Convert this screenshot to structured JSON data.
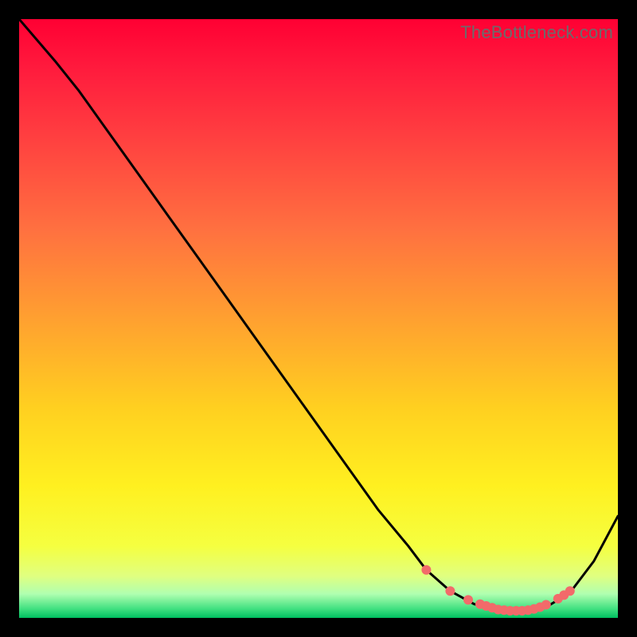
{
  "watermark": "TheBottleneck.com",
  "chart_data": {
    "type": "line",
    "title": "",
    "xlabel": "",
    "ylabel": "",
    "xlim": [
      0,
      100
    ],
    "ylim": [
      0,
      100
    ],
    "grid": false,
    "series": [
      {
        "name": "curve",
        "x": [
          0,
          6,
          10,
          15,
          20,
          25,
          30,
          35,
          40,
          45,
          50,
          55,
          60,
          65,
          68,
          72,
          76,
          80,
          84,
          88,
          92,
          96,
          100
        ],
        "y": [
          100,
          93,
          88,
          81,
          74,
          67,
          60,
          53,
          46,
          39,
          32,
          25,
          18,
          12,
          8,
          4.5,
          2.3,
          1.4,
          1.2,
          1.8,
          4.2,
          9.5,
          17
        ]
      }
    ],
    "markers": {
      "name": "dots",
      "color": "#f26a6a",
      "x": [
        68,
        72,
        75,
        77,
        78,
        79,
        80,
        81,
        82,
        83,
        84,
        85,
        86,
        87,
        88,
        90,
        91,
        92
      ],
      "y": [
        8.0,
        4.5,
        3.0,
        2.3,
        2.0,
        1.7,
        1.4,
        1.3,
        1.2,
        1.2,
        1.2,
        1.3,
        1.5,
        1.8,
        2.2,
        3.2,
        3.8,
        4.5
      ]
    },
    "gradient_stops": [
      {
        "offset": 0.0,
        "color": "#ff0033"
      },
      {
        "offset": 0.08,
        "color": "#ff1a3d"
      },
      {
        "offset": 0.2,
        "color": "#ff4040"
      },
      {
        "offset": 0.35,
        "color": "#ff7040"
      },
      {
        "offset": 0.5,
        "color": "#ffa030"
      },
      {
        "offset": 0.65,
        "color": "#ffd020"
      },
      {
        "offset": 0.78,
        "color": "#fff020"
      },
      {
        "offset": 0.88,
        "color": "#f5ff40"
      },
      {
        "offset": 0.93,
        "color": "#e0ff80"
      },
      {
        "offset": 0.96,
        "color": "#b0ffb0"
      },
      {
        "offset": 0.985,
        "color": "#40e080"
      },
      {
        "offset": 1.0,
        "color": "#00c060"
      }
    ]
  }
}
